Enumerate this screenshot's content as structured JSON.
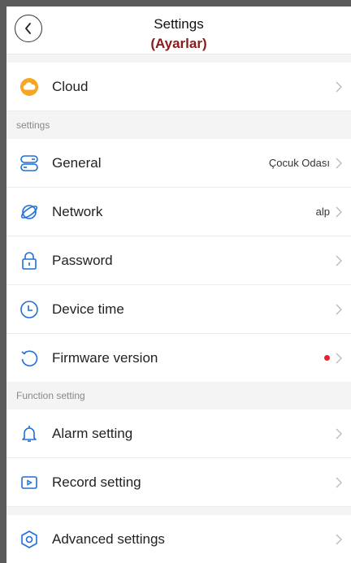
{
  "header": {
    "title": "Settings",
    "subtitle": "(Ayarlar)",
    "back_icon": "chevron-left-icon"
  },
  "cloud": {
    "label": "Cloud",
    "icon": "cloud-icon",
    "icon_color": "#f5a623"
  },
  "sections": {
    "settings_label": "settings",
    "function_label": "Function setting"
  },
  "items": {
    "general": {
      "label": "General",
      "value": "Çocuk Odası",
      "icon": "toggle-panel-icon"
    },
    "network": {
      "label": "Network",
      "value": "alp",
      "icon": "planet-icon"
    },
    "password": {
      "label": "Password",
      "icon": "lock-icon"
    },
    "device_time": {
      "label": "Device time",
      "icon": "clock-icon"
    },
    "firmware": {
      "label": "Firmware version",
      "icon": "refresh-icon",
      "badge_color": "#e8212b"
    },
    "alarm": {
      "label": "Alarm setting",
      "icon": "bell-icon"
    },
    "record": {
      "label": "Record setting",
      "icon": "play-box-icon"
    },
    "advanced": {
      "label": "Advanced settings",
      "icon": "hexagon-gear-icon"
    }
  },
  "colors": {
    "accent": "#1e6fd9",
    "divider": "#ececec",
    "section_bg": "#f4f4f4"
  }
}
